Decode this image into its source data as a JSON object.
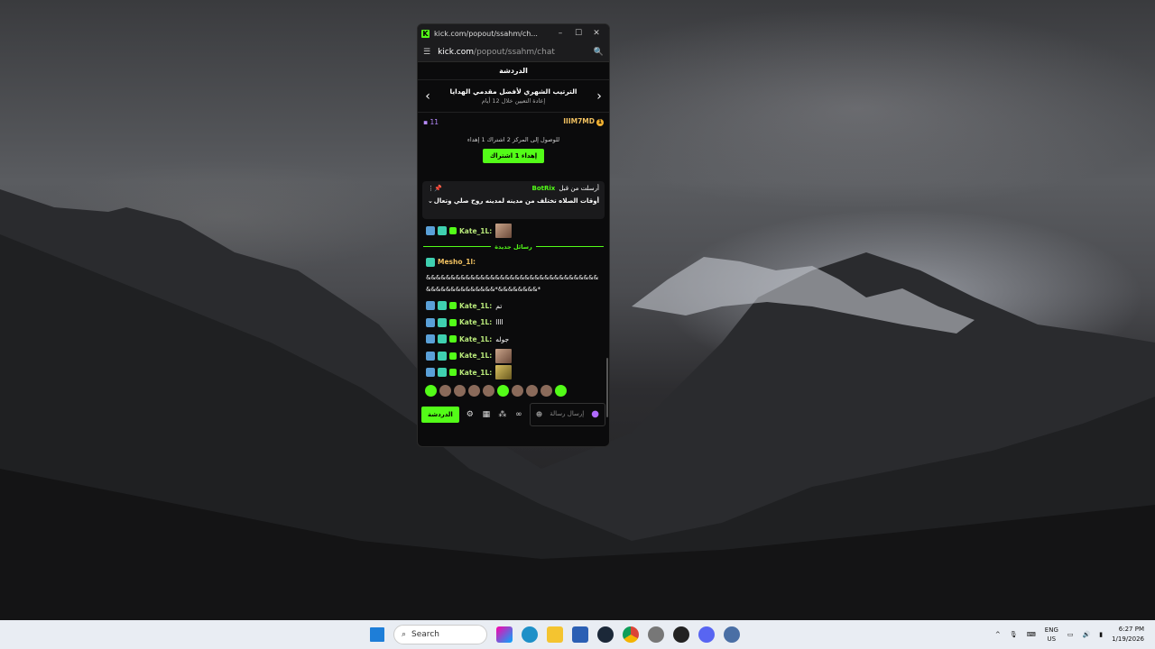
{
  "window": {
    "title": "kick.com/popout/ssahm/ch...",
    "url_host": "kick.com",
    "url_path": "/popout/ssahm/chat"
  },
  "chat": {
    "header": "الدردشة",
    "leaderboard_title": "الترتيب الشهري لأفضل مقدمي الهدايا",
    "leaderboard_sub": "إعادة التعيين خلال 12 أيام",
    "top_count": "11",
    "top_user": "IIIM7MD",
    "top_rank": "1",
    "goal_text": "للوصول إلى المركز 2 اشتراك 1 إهداء",
    "gift_button": "إهداء 1 اشتراك",
    "pinned_by": "أرسلت من قبل",
    "pinned_user": "BotRix",
    "pinned_message": "أوقات الصلاه تختلف من مدينه لمدينه روح صلي وتعال",
    "new_messages": "رسائل جديدة",
    "messages": [
      {
        "user": "Kate_1L:",
        "text": ""
      },
      {
        "user": "Mesho_1l:",
        "text": "&&&&&&&&&&&&&&&&&&&&&&&&&&&&&&&&&&&&&&&&&&&&&&&&&*&&&&&&&&*"
      },
      {
        "user": "Kate_1L:",
        "text": "تم"
      },
      {
        "user": "Kate_1L:",
        "text": "llll"
      },
      {
        "user": "Kate_1L:",
        "text": "جوله"
      },
      {
        "user": "Kate_1L:",
        "text": ""
      },
      {
        "user": "Kate_1L:",
        "text": ""
      }
    ],
    "send_button": "الدردشة",
    "input_placeholder": "إرسال رسالة"
  },
  "taskbar": {
    "search_placeholder": "Search",
    "lang_top": "ENG",
    "lang_bottom": "US",
    "time": "6:27 PM",
    "date": "1/19/2026"
  },
  "colors": {
    "accent": "#53fc18",
    "taskbar": "#e9edf3"
  }
}
